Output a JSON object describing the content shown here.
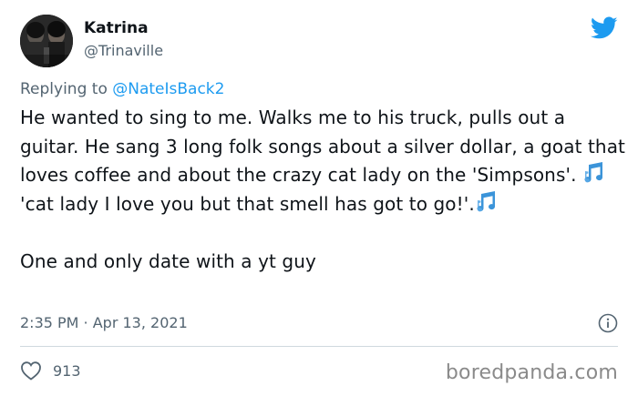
{
  "author": {
    "name": "Katrina",
    "handle": "@Trinaville",
    "avatar_icon": "profile-photo"
  },
  "reply": {
    "prefix": "Replying to ",
    "mention": "@NateIsBack2"
  },
  "body": {
    "paragraph_1_part_1": "He wanted to sing to me. Walks me to his truck, pulls out a guitar. He sang 3 long folk songs about a silver dollar, a goat that loves coffee and about the crazy cat lady on the 'Simpsons'. ",
    "paragraph_1_part_2": " 'cat lady I love you but that smell has got to go!'.",
    "paragraph_2": "One and only date with a yt guy",
    "emoji": "musical-notes-icon"
  },
  "meta": {
    "timestamp": "2:35 PM · Apr 13, 2021",
    "likes": "913"
  },
  "watermark": "boredpanda.com",
  "colors": {
    "twitter_blue": "#1d9bf0",
    "text_primary": "#0f1419",
    "text_secondary": "#536471",
    "divider": "#cfd9de",
    "watermark": "#8a8a8a"
  }
}
